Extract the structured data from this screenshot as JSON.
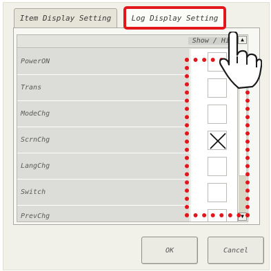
{
  "tabs": {
    "item_display": "Item Display Setting",
    "log_display": "Log Display Setting"
  },
  "table": {
    "header_show": "Show / Hide",
    "rows": [
      {
        "name": "PowerON",
        "checked": false
      },
      {
        "name": "Trans",
        "checked": false
      },
      {
        "name": "ModeChg",
        "checked": false
      },
      {
        "name": "ScrnChg",
        "checked": true
      },
      {
        "name": "LangChg",
        "checked": false
      },
      {
        "name": "Switch",
        "checked": false
      },
      {
        "name": "PrevChg",
        "checked": false
      }
    ]
  },
  "buttons": {
    "ok": "OK",
    "cancel": "Cancel"
  },
  "icons": {
    "scroll_up": "triangle-up-icon",
    "scroll_down": "triangle-down-icon",
    "pointer": "pointing-hand-icon"
  },
  "colors": {
    "highlight": "#e3161b"
  }
}
